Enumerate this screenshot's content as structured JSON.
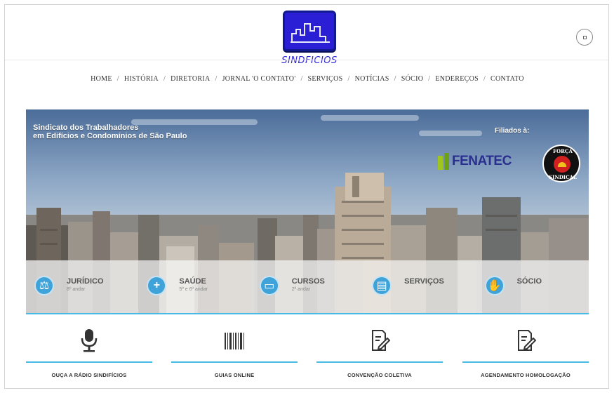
{
  "logo": {
    "text": "SINDFICIOS"
  },
  "nav": [
    "HOME",
    "HISTÓRIA",
    "DIRETORIA",
    "JORNAL 'O CONTATO'",
    "SERVIÇOS",
    "NOTÍCIAS",
    "SÓCIO",
    "ENDEREÇOS",
    "CONTATO"
  ],
  "hero": {
    "title_line1": "Sindicato dos Trabalhadores",
    "title_line2": "em Edifícios e Condomínios de São Paulo",
    "filiados": "Filiados à:",
    "fenatec": "FENATEC",
    "forca_top": "FORÇA",
    "forca_bottom": "SINDICAL"
  },
  "services": [
    {
      "title": "JURÍDICO",
      "sub": "8º andar",
      "icon": "scales-icon"
    },
    {
      "title": "SAÚDE",
      "sub": "5º e 6º andar",
      "icon": "plus-icon"
    },
    {
      "title": "CURSOS",
      "sub": "2º andar",
      "icon": "book-icon"
    },
    {
      "title": "SERVIÇOS",
      "sub": "",
      "icon": "document-icon"
    },
    {
      "title": "SÓCIO",
      "sub": "",
      "icon": "handshake-icon"
    }
  ],
  "quick": [
    {
      "label": "OUÇA A RÁDIO SINDIFÍCIOS",
      "icon": "microphone-icon"
    },
    {
      "label": "GUIAS ONLINE",
      "icon": "barcode-icon"
    },
    {
      "label": "CONVENÇÃO COLETIVA",
      "icon": "edit-document-icon"
    },
    {
      "label": "AGENDAMENTO HOMOLOGAÇÃO",
      "icon": "edit-document-icon"
    }
  ],
  "colors": {
    "accent": "#49b9e6",
    "logo_blue": "#2b1fd6",
    "service_icon": "#3fa3d9"
  }
}
